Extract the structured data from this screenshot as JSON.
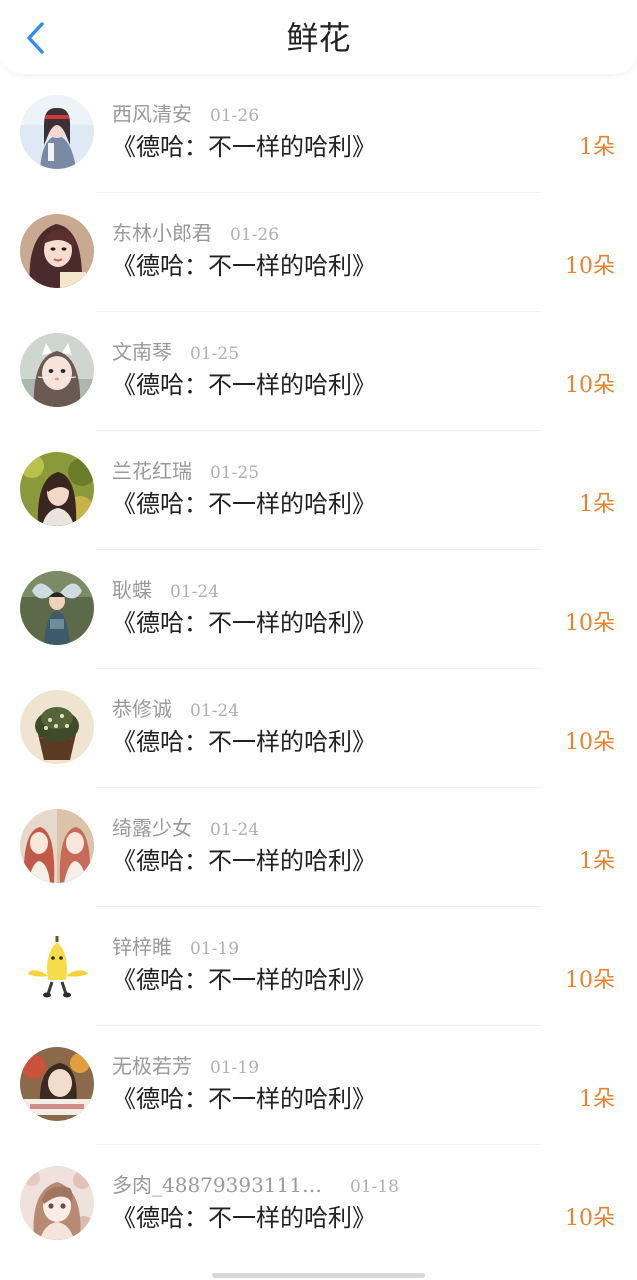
{
  "header": {
    "title": "鲜花",
    "back_icon": "chevron-left-icon",
    "accent_color": "#2d8cf0"
  },
  "items": [
    {
      "name": "西风清安",
      "date": "01-26",
      "book": "《德哈：不一样的哈利》",
      "flowers": "1朵",
      "avatar": "girl-portrait"
    },
    {
      "name": "东林小郎君",
      "date": "01-26",
      "book": "《德哈：不一样的哈利》",
      "flowers": "10朵",
      "avatar": "woman-selfie"
    },
    {
      "name": "文南琴",
      "date": "01-25",
      "book": "《德哈：不一样的哈利》",
      "flowers": "10朵",
      "avatar": "cat-filter-selfie"
    },
    {
      "name": "兰花红瑞",
      "date": "01-25",
      "book": "《德哈：不一样的哈利》",
      "flowers": "1朵",
      "avatar": "girl-in-greenery"
    },
    {
      "name": "耿蝶",
      "date": "01-24",
      "book": "《德哈：不一样的哈利》",
      "flowers": "10朵",
      "avatar": "butterfly-child"
    },
    {
      "name": "恭修诚",
      "date": "01-24",
      "book": "《德哈：不一样的哈利》",
      "flowers": "10朵",
      "avatar": "cupcake"
    },
    {
      "name": "绮露少女",
      "date": "01-24",
      "book": "《德哈：不一样的哈利》",
      "flowers": "1朵",
      "avatar": "anime-twins"
    },
    {
      "name": "锌梓睢",
      "date": "01-19",
      "book": "《德哈：不一样的哈利》",
      "flowers": "10朵",
      "avatar": "banana-character"
    },
    {
      "name": "无极若芳",
      "date": "01-19",
      "book": "《德哈：不一样的哈利》",
      "flowers": "1朵",
      "avatar": "girl-with-caption"
    },
    {
      "name": "多肉_48879393111…",
      "date": "01-18",
      "book": "《德哈：不一样的哈利》",
      "flowers": "10朵",
      "avatar": "vintage-doll"
    }
  ]
}
